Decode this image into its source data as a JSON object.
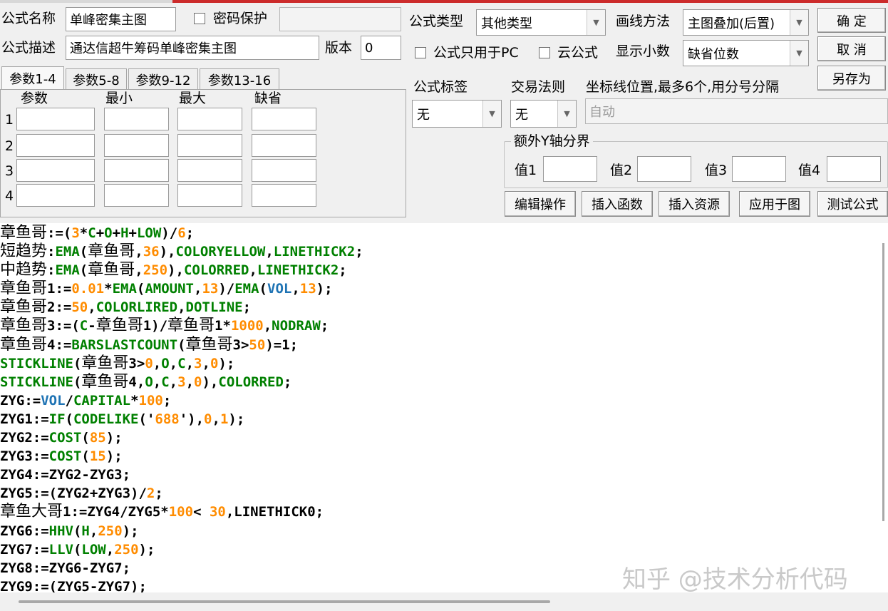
{
  "header": {
    "name_label": "公式名称",
    "name_value": "单峰密集主图",
    "password_label": "密码保护",
    "password_value": "",
    "desc_label": "公式描述",
    "desc_value": "通达信超牛筹码单峰密集主图",
    "version_label": "版本",
    "version_value": "0",
    "type_label": "公式类型",
    "type_value": "其他类型",
    "draw_label": "画线方法",
    "draw_value": "主图叠加(后置)",
    "pc_only_label": "公式只用于PC",
    "cloud_label": "云公式",
    "decimals_label": "显示小数",
    "decimals_value": "缺省位数"
  },
  "buttons": {
    "ok": "确 定",
    "cancel": "取 消",
    "save_as": "另存为",
    "edit_ops": "编辑操作",
    "insert_func": "插入函数",
    "insert_res": "插入资源",
    "apply_chart": "应用于图",
    "test_formula": "测试公式"
  },
  "tabs": [
    "参数1-4",
    "参数5-8",
    "参数9-12",
    "参数13-16"
  ],
  "param_headers": [
    "参数",
    "最小",
    "最大",
    "缺省"
  ],
  "param_rows": [
    "1",
    "2",
    "3",
    "4"
  ],
  "right": {
    "tag_label": "公式标签",
    "tag_value": "无",
    "rule_label": "交易法则",
    "rule_value": "无",
    "coord_label": "坐标线位置,最多6个,用分号分隔",
    "coord_value": "自动",
    "yaxis_label": "额外Y轴分界",
    "v1": "值1",
    "v2": "值2",
    "v3": "值3",
    "v4": "值4"
  },
  "colors": {
    "black": "#000000",
    "green": "#008000",
    "orange": "#ff8c00",
    "blue": "#1e73b4"
  },
  "code": [
    [
      [
        "章鱼哥",
        "z"
      ],
      [
        ":=(",
        "k"
      ],
      [
        "3",
        "o"
      ],
      [
        "*",
        "k"
      ],
      [
        "C",
        "g"
      ],
      [
        "+",
        "k"
      ],
      [
        "O",
        "g"
      ],
      [
        "+",
        "k"
      ],
      [
        "H",
        "g"
      ],
      [
        "+",
        "k"
      ],
      [
        "LOW",
        "g"
      ],
      [
        ")/",
        "k"
      ],
      [
        "6",
        "o"
      ],
      [
        ";",
        "k"
      ]
    ],
    [
      [
        "短趋势",
        "z"
      ],
      [
        ":",
        "k"
      ],
      [
        "EMA",
        "g"
      ],
      [
        "(",
        "k"
      ],
      [
        "章鱼哥",
        "z"
      ],
      [
        ",",
        "k"
      ],
      [
        "36",
        "o"
      ],
      [
        "),",
        "k"
      ],
      [
        "COLORYELLOW",
        "g"
      ],
      [
        ",",
        "k"
      ],
      [
        "LINETHICK2",
        "g"
      ],
      [
        ";",
        "k"
      ]
    ],
    [
      [
        "中趋势",
        "z"
      ],
      [
        ":",
        "k"
      ],
      [
        "EMA",
        "g"
      ],
      [
        "(",
        "k"
      ],
      [
        "章鱼哥",
        "z"
      ],
      [
        ",",
        "k"
      ],
      [
        "250",
        "o"
      ],
      [
        "),",
        "k"
      ],
      [
        "COLORRED",
        "g"
      ],
      [
        ",",
        "k"
      ],
      [
        "LINETHICK2",
        "g"
      ],
      [
        ";",
        "k"
      ]
    ],
    [
      [
        "章鱼哥",
        "z"
      ],
      [
        "1:=",
        "k"
      ],
      [
        "0.01",
        "o"
      ],
      [
        "*",
        "k"
      ],
      [
        "EMA",
        "g"
      ],
      [
        "(",
        "k"
      ],
      [
        "AMOUNT",
        "g"
      ],
      [
        ",",
        "k"
      ],
      [
        "13",
        "o"
      ],
      [
        ")/",
        "k"
      ],
      [
        "EMA",
        "g"
      ],
      [
        "(",
        "k"
      ],
      [
        "VOL",
        "b"
      ],
      [
        ",",
        "k"
      ],
      [
        "13",
        "o"
      ],
      [
        ");",
        "k"
      ]
    ],
    [
      [
        "章鱼哥",
        "z"
      ],
      [
        "2:=",
        "k"
      ],
      [
        "50",
        "o"
      ],
      [
        ",",
        "k"
      ],
      [
        "COLORLIRED",
        "g"
      ],
      [
        ",",
        "k"
      ],
      [
        "DOTLINE",
        "g"
      ],
      [
        ";",
        "k"
      ]
    ],
    [
      [
        "章鱼哥",
        "z"
      ],
      [
        "3:=(",
        "k"
      ],
      [
        "C",
        "g"
      ],
      [
        "-",
        "k"
      ],
      [
        "章鱼哥",
        "z"
      ],
      [
        "1)/",
        "k"
      ],
      [
        "章鱼哥",
        "z"
      ],
      [
        "1*",
        "k"
      ],
      [
        "1000",
        "o"
      ],
      [
        ",",
        "k"
      ],
      [
        "NODRAW",
        "g"
      ],
      [
        ";",
        "k"
      ]
    ],
    [
      [
        "章鱼哥",
        "z"
      ],
      [
        "4:=",
        "k"
      ],
      [
        "BARSLASTCOUNT",
        "g"
      ],
      [
        "(",
        "k"
      ],
      [
        "章鱼哥",
        "z"
      ],
      [
        "3>",
        "k"
      ],
      [
        "50",
        "o"
      ],
      [
        ")=1;",
        "k"
      ]
    ],
    [
      [
        "STICKLINE",
        "g"
      ],
      [
        "(",
        "k"
      ],
      [
        "章鱼哥",
        "z"
      ],
      [
        "3>",
        "k"
      ],
      [
        "0",
        "o"
      ],
      [
        ",",
        "k"
      ],
      [
        "O",
        "g"
      ],
      [
        ",",
        "k"
      ],
      [
        "C",
        "g"
      ],
      [
        ",",
        "k"
      ],
      [
        "3",
        "o"
      ],
      [
        ",",
        "k"
      ],
      [
        "0",
        "o"
      ],
      [
        ");",
        "k"
      ]
    ],
    [
      [
        "STICKLINE",
        "g"
      ],
      [
        "(",
        "k"
      ],
      [
        "章鱼哥",
        "z"
      ],
      [
        "4,",
        "k"
      ],
      [
        "O",
        "g"
      ],
      [
        ",",
        "k"
      ],
      [
        "C",
        "g"
      ],
      [
        ",",
        "k"
      ],
      [
        "3",
        "o"
      ],
      [
        ",",
        "k"
      ],
      [
        "0",
        "o"
      ],
      [
        "),",
        "k"
      ],
      [
        "COLORRED",
        "g"
      ],
      [
        ";",
        "k"
      ]
    ],
    [
      [
        "ZYG:=",
        "k"
      ],
      [
        "VOL",
        "b"
      ],
      [
        "/",
        "k"
      ],
      [
        "CAPITAL",
        "g"
      ],
      [
        "*",
        "k"
      ],
      [
        "100",
        "o"
      ],
      [
        ";",
        "k"
      ]
    ],
    [
      [
        "ZYG1:=",
        "k"
      ],
      [
        "IF",
        "g"
      ],
      [
        "(",
        "k"
      ],
      [
        "CODELIKE",
        "g"
      ],
      [
        "('",
        "k"
      ],
      [
        "688",
        "o"
      ],
      [
        "'),",
        "k"
      ],
      [
        "0",
        "o"
      ],
      [
        ",",
        "k"
      ],
      [
        "1",
        "o"
      ],
      [
        ");",
        "k"
      ]
    ],
    [
      [
        "ZYG2:=",
        "k"
      ],
      [
        "COST",
        "g"
      ],
      [
        "(",
        "k"
      ],
      [
        "85",
        "o"
      ],
      [
        ");",
        "k"
      ]
    ],
    [
      [
        "ZYG3:=",
        "k"
      ],
      [
        "COST",
        "g"
      ],
      [
        "(",
        "k"
      ],
      [
        "15",
        "o"
      ],
      [
        ");",
        "k"
      ]
    ],
    [
      [
        "ZYG4:=ZYG2-ZYG3;",
        "k"
      ]
    ],
    [
      [
        "ZYG5:=(ZYG2+ZYG3)/",
        "k"
      ],
      [
        "2",
        "o"
      ],
      [
        ";",
        "k"
      ]
    ],
    [
      [
        "章鱼大哥",
        "z"
      ],
      [
        "1:=ZYG4/ZYG5*",
        "k"
      ],
      [
        "100",
        "o"
      ],
      [
        "< ",
        "k"
      ],
      [
        "30",
        "o"
      ],
      [
        ",LINETHICK0;",
        "k"
      ]
    ],
    [
      [
        "ZYG6:=",
        "k"
      ],
      [
        "HHV",
        "g"
      ],
      [
        "(",
        "k"
      ],
      [
        "H",
        "g"
      ],
      [
        ",",
        "k"
      ],
      [
        "250",
        "o"
      ],
      [
        ");",
        "k"
      ]
    ],
    [
      [
        "ZYG7:=",
        "k"
      ],
      [
        "LLV",
        "g"
      ],
      [
        "(",
        "k"
      ],
      [
        "LOW",
        "g"
      ],
      [
        ",",
        "k"
      ],
      [
        "250",
        "o"
      ],
      [
        ");",
        "k"
      ]
    ],
    [
      [
        "ZYG8:=ZYG6-ZYG7;",
        "k"
      ]
    ],
    [
      [
        "ZYG9:=(ZYG5-ZYG7);",
        "k"
      ]
    ]
  ],
  "watermark": "知乎 @技术分析代码"
}
